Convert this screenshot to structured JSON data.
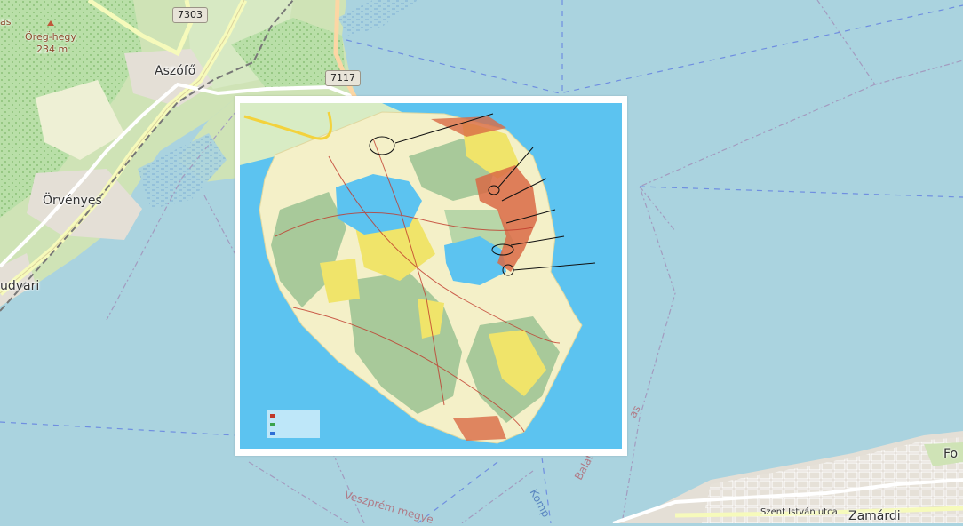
{
  "map": {
    "places": {
      "aszofo": "Aszófő",
      "orvenyes": "Örvényes",
      "udvari": "udvari",
      "zamardi": "Zamárdi",
      "fo": "Fo"
    },
    "peak": {
      "name": "Öreg-hegy",
      "elevation": "234 m"
    },
    "peak_top": "as",
    "road_shields": [
      "7303",
      "7117"
    ],
    "admin_labels": {
      "county": "Veszprém megye",
      "balaton": "Balato",
      "balaton_tail": "as"
    },
    "ferry_label": "Komp",
    "street": "Szent István utca",
    "colors": {
      "water": "#aad3df",
      "land": "#f2efe9",
      "vineyard": "#aedfa3",
      "main_road": "#f6fabb",
      "admin_boundary": "#a39bbf"
    }
  },
  "overlay": {
    "kind": "trail map of the Tihany peninsula",
    "colors": {
      "sea": "#5cc3f0",
      "forest": "#a8c99a",
      "open_land": "#f4f0c8",
      "fields": "#f0e46a",
      "settlement": "#d96a45"
    }
  }
}
